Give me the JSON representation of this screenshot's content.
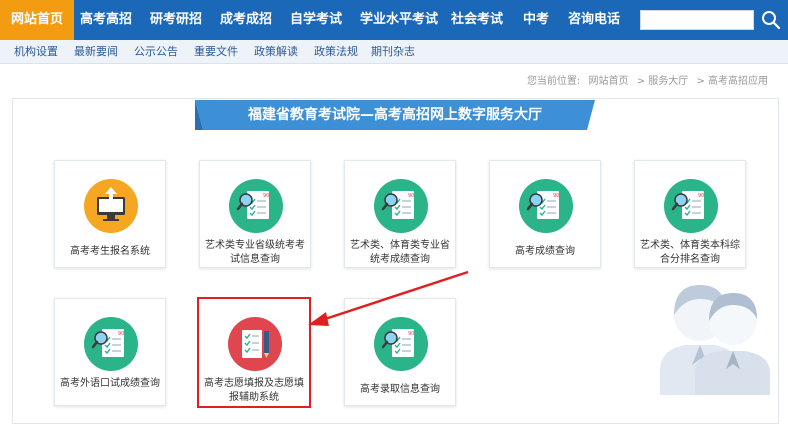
{
  "topnav": {
    "items": [
      "网站首页",
      "高考高招",
      "研考研招",
      "成考成招",
      "自学考试",
      "学业水平考试",
      "社会考试",
      "中考",
      "咨询电话"
    ],
    "search_placeholder": ""
  },
  "subnav": {
    "items": [
      "机构设置",
      "最新要闻",
      "公示公告",
      "重要文件",
      "政策解读",
      "政策法规",
      "期刊杂志"
    ]
  },
  "breadcrumb": {
    "prefix": "您当前位置:",
    "items": [
      "网站首页",
      ">  服务大厅",
      ">  高考高招应用"
    ]
  },
  "panel": {
    "title": "福建省教育考试院—高考高招网上数字服务大厅",
    "tiles": [
      {
        "label": "高考考生报名系统",
        "icon": "upload-computer-icon",
        "color": "#f5a623"
      },
      {
        "label": "艺术类专业省级统考考试信息查询",
        "icon": "document-search-icon",
        "color": "#2bb38a"
      },
      {
        "label": "艺术类、体育类专业省统考成绩查询",
        "icon": "document-search-icon",
        "color": "#2bb38a"
      },
      {
        "label": "高考成绩查询",
        "icon": "document-search-icon",
        "color": "#2bb38a"
      },
      {
        "label": "艺术类、体育类本科综合分排名查询",
        "icon": "document-search-icon",
        "color": "#2bb38a"
      },
      {
        "label": "高考外语口试成绩查询",
        "icon": "document-search-icon",
        "color": "#2bb38a"
      },
      {
        "label": "高考志愿填报及志愿填报辅助系统",
        "icon": "checklist-pencil-icon",
        "color": "#e0464f"
      },
      {
        "label": "高考录取信息查询",
        "icon": "document-search-icon",
        "color": "#2bb38a"
      }
    ]
  },
  "colors": {
    "nav_bg": "#1b68b8",
    "nav_active": "#f39c12",
    "ribbon": "#3d8fd6",
    "highlight": "#e02020"
  }
}
